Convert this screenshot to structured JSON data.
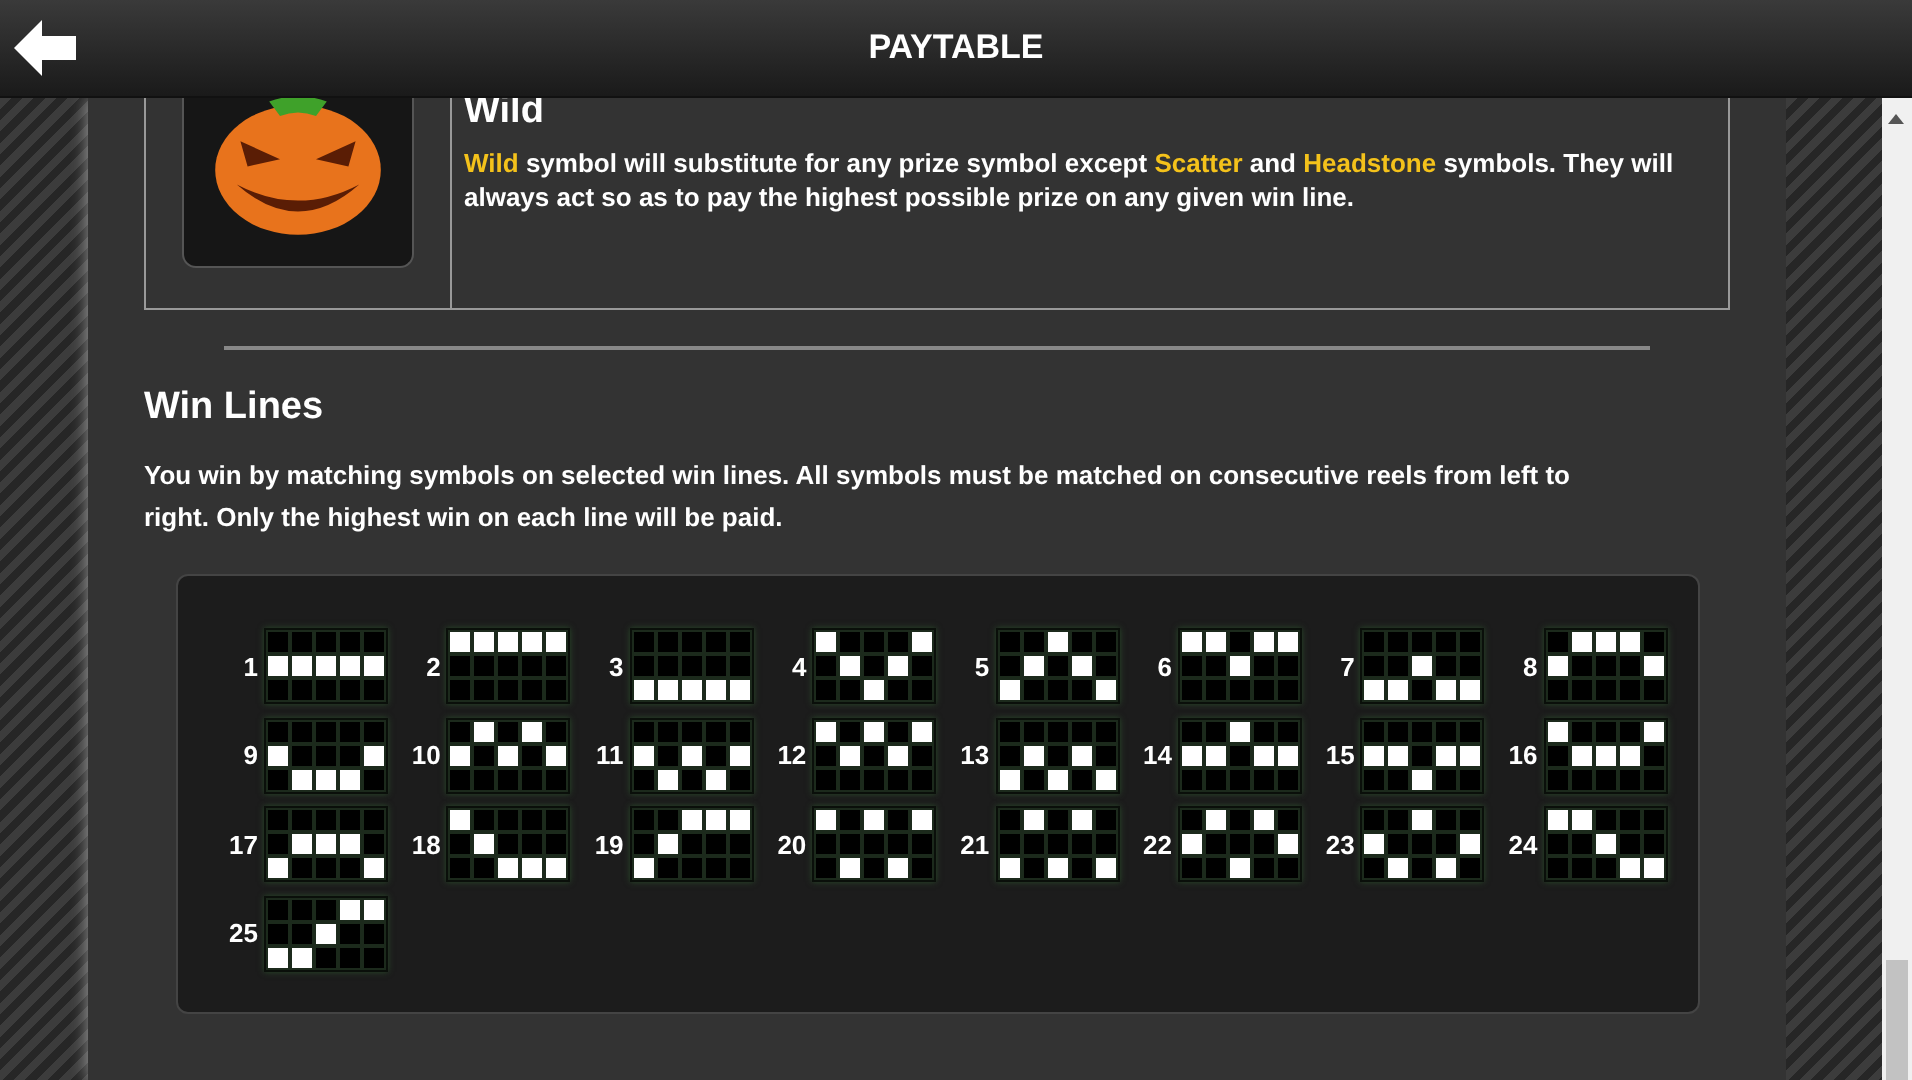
{
  "header": {
    "title": "PAYTABLE"
  },
  "wild": {
    "title": "Wild",
    "text": "**Wild** symbol will substitute for any prize symbol except **Scatter** and **Headstone** symbols. They will always act so as to pay the highest possible prize on any given win line."
  },
  "win_lines": {
    "title": "Win Lines",
    "text": "You win by matching symbols on selected win lines. All symbols must be matched on consecutive reels from left to right. Only the highest win on each line will be paid.",
    "lines": [
      {
        "number": "1",
        "rows": [
          [
            false,
            false,
            false,
            false,
            false
          ],
          [
            true,
            true,
            true,
            true,
            true
          ],
          [
            false,
            false,
            false,
            false,
            false
          ]
        ]
      },
      {
        "number": "2",
        "rows": [
          [
            true,
            true,
            true,
            true,
            true
          ],
          [
            false,
            false,
            false,
            false,
            false
          ],
          [
            false,
            false,
            false,
            false,
            false
          ]
        ]
      },
      {
        "number": "3",
        "rows": [
          [
            false,
            false,
            false,
            false,
            false
          ],
          [
            false,
            false,
            false,
            false,
            false
          ],
          [
            true,
            true,
            true,
            true,
            true
          ]
        ]
      },
      {
        "number": "4",
        "rows": [
          [
            true,
            false,
            false,
            false,
            true
          ],
          [
            false,
            true,
            false,
            true,
            false
          ],
          [
            false,
            false,
            true,
            false,
            false
          ]
        ]
      },
      {
        "number": "5",
        "rows": [
          [
            false,
            false,
            true,
            false,
            false
          ],
          [
            false,
            true,
            false,
            true,
            false
          ],
          [
            true,
            false,
            false,
            false,
            true
          ]
        ]
      },
      {
        "number": "6",
        "rows": [
          [
            true,
            true,
            false,
            true,
            true
          ],
          [
            false,
            false,
            true,
            false,
            false
          ],
          [
            false,
            false,
            false,
            false,
            false
          ]
        ]
      },
      {
        "number": "7",
        "rows": [
          [
            false,
            false,
            false,
            false,
            false
          ],
          [
            false,
            false,
            true,
            false,
            false
          ],
          [
            true,
            true,
            false,
            true,
            true
          ]
        ]
      },
      {
        "number": "8",
        "rows": [
          [
            false,
            true,
            true,
            true,
            false
          ],
          [
            true,
            false,
            false,
            false,
            true
          ],
          [
            false,
            false,
            false,
            false,
            false
          ]
        ]
      },
      {
        "number": "9",
        "rows": [
          [
            false,
            false,
            false,
            false,
            false
          ],
          [
            true,
            false,
            false,
            false,
            true
          ],
          [
            false,
            true,
            true,
            true,
            false
          ]
        ]
      },
      {
        "number": "10",
        "rows": [
          [
            false,
            true,
            false,
            true,
            false
          ],
          [
            true,
            false,
            true,
            false,
            true
          ],
          [
            false,
            false,
            false,
            false,
            false
          ]
        ]
      },
      {
        "number": "11",
        "rows": [
          [
            false,
            false,
            false,
            false,
            false
          ],
          [
            true,
            false,
            true,
            false,
            true
          ],
          [
            false,
            true,
            false,
            true,
            false
          ]
        ]
      },
      {
        "number": "12",
        "rows": [
          [
            true,
            false,
            true,
            false,
            true
          ],
          [
            false,
            true,
            false,
            true,
            false
          ],
          [
            false,
            false,
            false,
            false,
            false
          ]
        ]
      },
      {
        "number": "13",
        "rows": [
          [
            false,
            false,
            false,
            false,
            false
          ],
          [
            false,
            true,
            false,
            true,
            false
          ],
          [
            true,
            false,
            true,
            false,
            true
          ]
        ]
      },
      {
        "number": "14",
        "rows": [
          [
            false,
            false,
            true,
            false,
            false
          ],
          [
            true,
            true,
            false,
            true,
            true
          ],
          [
            false,
            false,
            false,
            false,
            false
          ]
        ]
      },
      {
        "number": "15",
        "rows": [
          [
            false,
            false,
            false,
            false,
            false
          ],
          [
            true,
            true,
            false,
            true,
            true
          ],
          [
            false,
            false,
            true,
            false,
            false
          ]
        ]
      },
      {
        "number": "16",
        "rows": [
          [
            true,
            false,
            false,
            false,
            true
          ],
          [
            false,
            true,
            true,
            true,
            false
          ],
          [
            false,
            false,
            false,
            false,
            false
          ]
        ]
      },
      {
        "number": "17",
        "rows": [
          [
            false,
            false,
            false,
            false,
            false
          ],
          [
            false,
            true,
            true,
            true,
            false
          ],
          [
            true,
            false,
            false,
            false,
            true
          ]
        ]
      },
      {
        "number": "18",
        "rows": [
          [
            true,
            false,
            false,
            false,
            false
          ],
          [
            false,
            true,
            false,
            false,
            false
          ],
          [
            false,
            false,
            true,
            true,
            true
          ]
        ]
      },
      {
        "number": "19",
        "rows": [
          [
            false,
            false,
            true,
            true,
            true
          ],
          [
            false,
            true,
            false,
            false,
            false
          ],
          [
            true,
            false,
            false,
            false,
            false
          ]
        ]
      },
      {
        "number": "20",
        "rows": [
          [
            true,
            false,
            true,
            false,
            true
          ],
          [
            false,
            false,
            false,
            false,
            false
          ],
          [
            false,
            true,
            false,
            true,
            false
          ]
        ]
      },
      {
        "number": "21",
        "rows": [
          [
            false,
            true,
            false,
            true,
            false
          ],
          [
            false,
            false,
            false,
            false,
            false
          ],
          [
            true,
            false,
            true,
            false,
            true
          ]
        ]
      },
      {
        "number": "22",
        "rows": [
          [
            false,
            true,
            false,
            true,
            false
          ],
          [
            true,
            false,
            false,
            false,
            true
          ],
          [
            false,
            false,
            true,
            false,
            false
          ]
        ]
      },
      {
        "number": "23",
        "rows": [
          [
            false,
            false,
            true,
            false,
            false
          ],
          [
            true,
            false,
            false,
            false,
            true
          ],
          [
            false,
            true,
            false,
            true,
            false
          ]
        ]
      },
      {
        "number": "24",
        "rows": [
          [
            true,
            true,
            false,
            false,
            false
          ],
          [
            false,
            false,
            true,
            false,
            false
          ],
          [
            false,
            false,
            false,
            true,
            true
          ]
        ]
      },
      {
        "number": "25",
        "rows": [
          [
            false,
            false,
            false,
            true,
            true
          ],
          [
            false,
            false,
            true,
            false,
            false
          ],
          [
            true,
            true,
            false,
            false,
            false
          ]
        ]
      }
    ]
  }
}
